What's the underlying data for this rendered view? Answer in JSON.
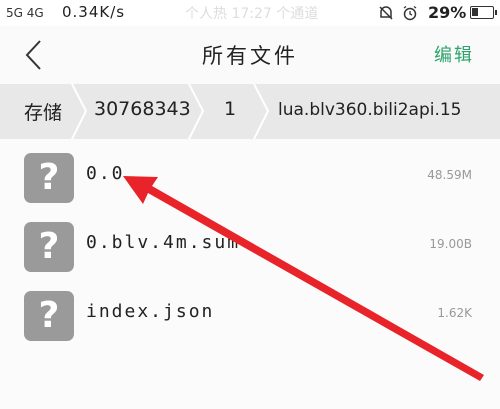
{
  "status_bar": {
    "signal": "5G 4G",
    "speed": "0.34K/s",
    "center": "个人热 17:27 个通道",
    "battery": "29%",
    "battery_level": 0.29
  },
  "header": {
    "title": "所有文件",
    "edit_label": "编辑"
  },
  "breadcrumb": {
    "root": "存储",
    "items": [
      "30768343",
      "1",
      "lua.blv360.bili2api.15"
    ]
  },
  "files": [
    {
      "name": "0.0",
      "size": "48.59M",
      "icon": "unknown-file-icon"
    },
    {
      "name": "0.blv.4m.sum",
      "size": "19.00B",
      "icon": "unknown-file-icon"
    },
    {
      "name": "index.json",
      "size": "1.62K",
      "icon": "unknown-file-icon"
    }
  ],
  "colors": {
    "accent": "#2fa36b",
    "annotation_arrow": "#e8232a",
    "icon_bg": "#9a9a9a"
  }
}
